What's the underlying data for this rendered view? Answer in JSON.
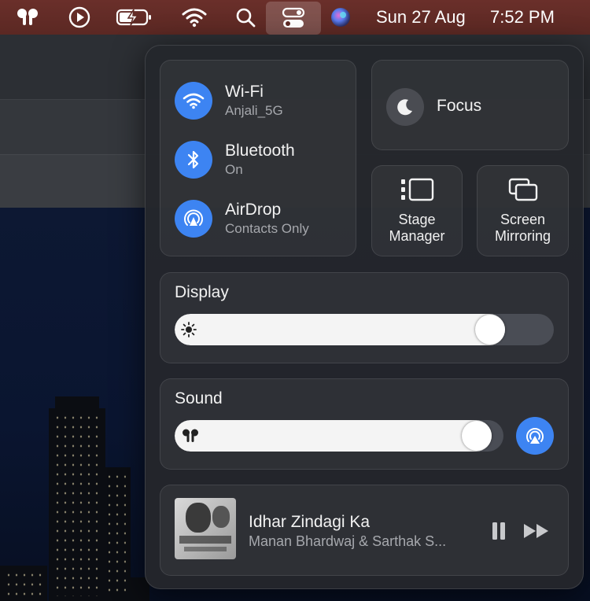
{
  "menubar": {
    "icons": [
      "airpods-icon",
      "play-icon",
      "battery-charging-icon",
      "wifi-icon",
      "search-icon",
      "control-center-icon",
      "siri-icon"
    ],
    "date": "Sun 27 Aug",
    "time": "7:52 PM"
  },
  "control_center": {
    "wifi": {
      "title": "Wi-Fi",
      "subtitle": "Anjali_5G"
    },
    "bluetooth": {
      "title": "Bluetooth",
      "subtitle": "On"
    },
    "airdrop": {
      "title": "AirDrop",
      "subtitle": "Contacts Only"
    },
    "focus": {
      "label": "Focus"
    },
    "stage_manager": {
      "label_line1": "Stage",
      "label_line2": "Manager"
    },
    "screen_mirroring": {
      "label_line1": "Screen",
      "label_line2": "Mirroring"
    },
    "display": {
      "title": "Display",
      "brightness_fraction": 0.86
    },
    "sound": {
      "title": "Sound",
      "volume_fraction": 0.96
    },
    "now_playing": {
      "title": "Idhar Zindagi Ka",
      "artist": "Manan Bhardwaj & Sarthak S..."
    }
  },
  "colors": {
    "accent_blue": "#3d84f2",
    "menubar": "#5e2a25"
  }
}
